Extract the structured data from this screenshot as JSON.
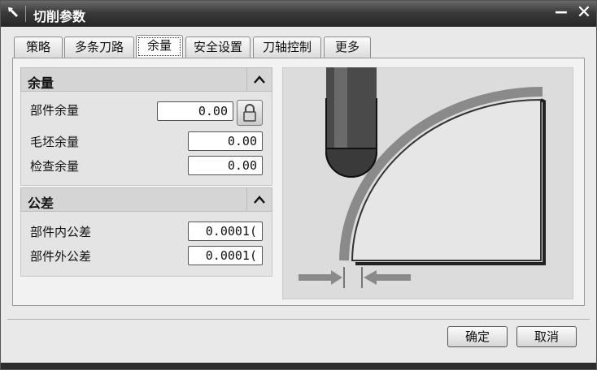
{
  "window": {
    "title": "切削参数",
    "minimize_label": "−",
    "close_label": "✕"
  },
  "tabs": [
    {
      "label": "策略",
      "active": false
    },
    {
      "label": "多条刀路",
      "active": false
    },
    {
      "label": "余量",
      "active": true
    },
    {
      "label": "安全设置",
      "active": false
    },
    {
      "label": "刀轴控制",
      "active": false
    },
    {
      "label": "更多",
      "active": false
    }
  ],
  "stock_group": {
    "title": "余量",
    "collapse_icon": "chevron-up-icon",
    "rows": [
      {
        "label": "部件余量",
        "value": "0.00"
      },
      {
        "label": "毛坯余量",
        "value": "0.00"
      },
      {
        "label": "检查余量",
        "value": "0.00"
      }
    ]
  },
  "tolerance_group": {
    "title": "公差",
    "collapse_icon": "chevron-up-icon",
    "rows": [
      {
        "label": "部件内公差",
        "value": "0.0001("
      },
      {
        "label": "部件外公差",
        "value": "0.0001("
      }
    ]
  },
  "buttons": {
    "ok": "确定",
    "cancel": "取消"
  },
  "colors": {
    "titlebar": "#333333",
    "panel": "#f2f2f2",
    "stock_band": "#8a8a8a"
  }
}
